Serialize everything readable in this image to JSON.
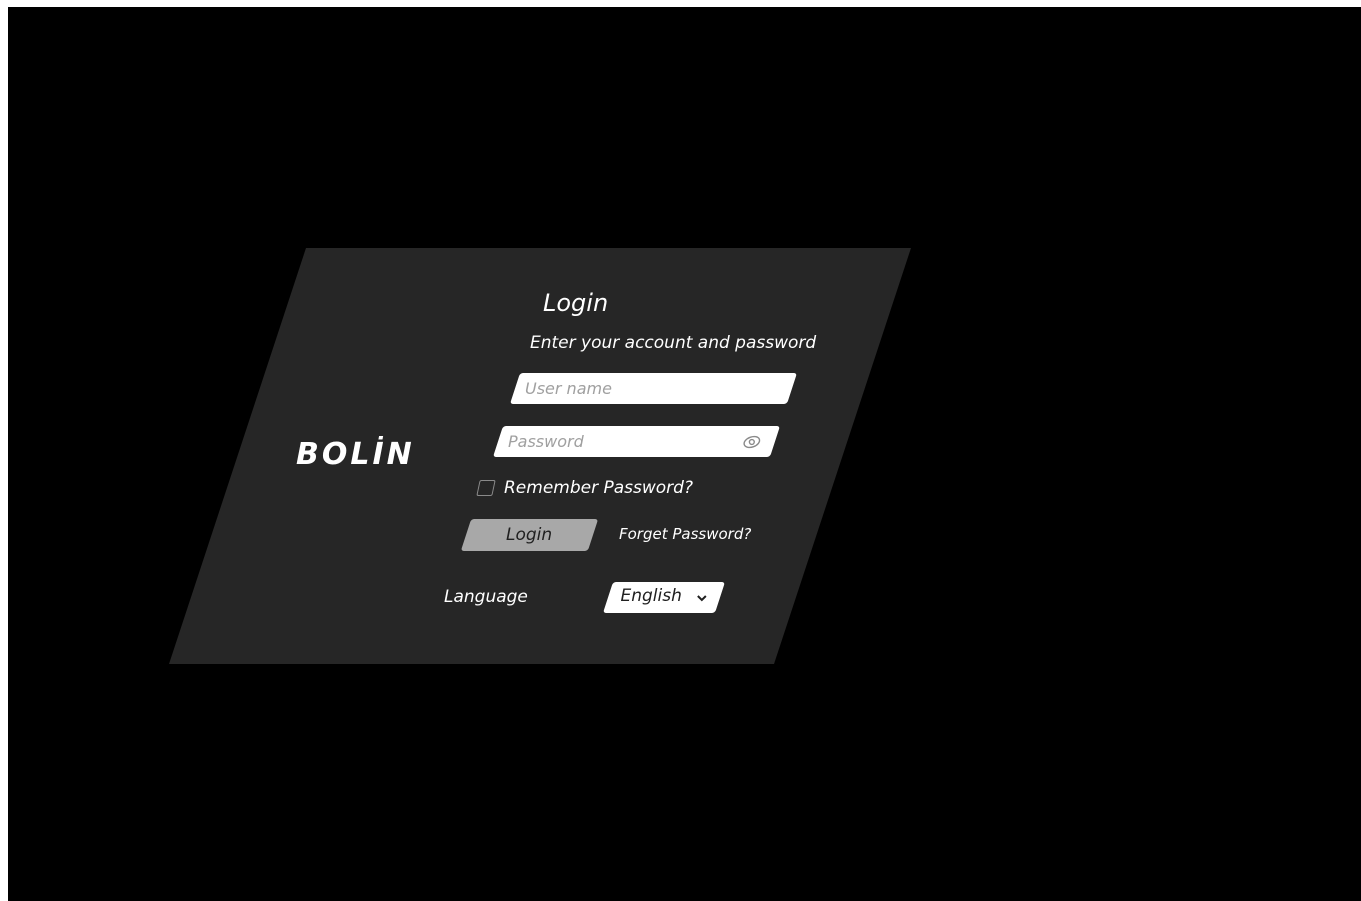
{
  "login": {
    "title": "Login",
    "subtitle": "Enter your account and password",
    "username_placeholder": "User name",
    "password_placeholder": "Password",
    "remember_label": "Remember Password?",
    "login_button": "Login",
    "forget_link": "Forget Password?",
    "language_label": "Language",
    "language_selected": "English"
  },
  "brand": {
    "logo_text": "BOLİN"
  },
  "icons": {
    "password_toggle": "eye-icon",
    "language_dropdown": "chevron-down-icon"
  },
  "colors": {
    "background": "#000000",
    "panel": "#262626",
    "button": "#a8a8a8",
    "text": "#ffffff"
  }
}
